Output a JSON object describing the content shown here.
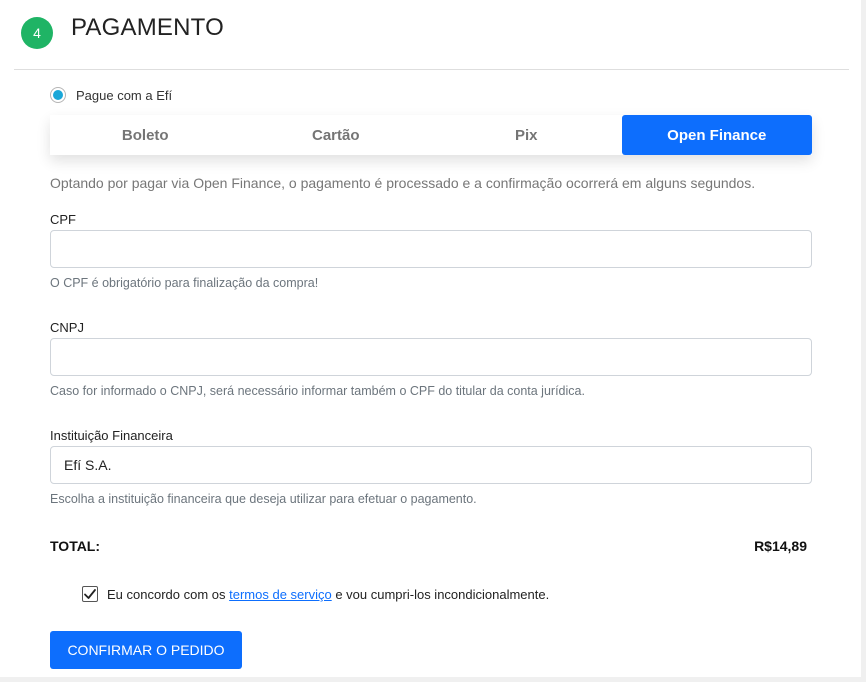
{
  "section": {
    "step_number": "4",
    "title": "PAGAMENTO"
  },
  "payment_option": {
    "label": "Pague com a Efí",
    "selected": true
  },
  "tabs": [
    {
      "label": "Boleto",
      "active": false
    },
    {
      "label": "Cartão",
      "active": false
    },
    {
      "label": "Pix",
      "active": false
    },
    {
      "label": "Open Finance",
      "active": true
    }
  ],
  "description": "Optando por pagar via Open Finance, o pagamento é processado e a confirmação ocorrerá em alguns segundos.",
  "fields": {
    "cpf": {
      "label": "CPF",
      "value": "",
      "help": "O CPF é obrigatório para finalização da compra!"
    },
    "cnpj": {
      "label": "CNPJ",
      "value": "",
      "help": "Caso for informado o CNPJ, será necessário informar também o CPF do titular da conta jurídica."
    },
    "institution": {
      "label": "Instituição Financeira",
      "value": "Efí S.A.",
      "help": "Escolha a instituição financeira que deseja utilizar para efetuar o pagamento."
    }
  },
  "total": {
    "label": "TOTAL:",
    "value": "R$14,89"
  },
  "agreement": {
    "checked": true,
    "text_before": "Eu concordo com os ",
    "link_text": "termos de serviço",
    "text_after": " e vou cumpri-los incondicionalmente."
  },
  "confirm_button": "CONFIRMAR O PEDIDO",
  "colors": {
    "step_badge": "#1fb465",
    "accent": "#0d6efd",
    "radio_dot": "#1aa7d8"
  },
  "icons": {
    "check": "checkmark-icon"
  }
}
